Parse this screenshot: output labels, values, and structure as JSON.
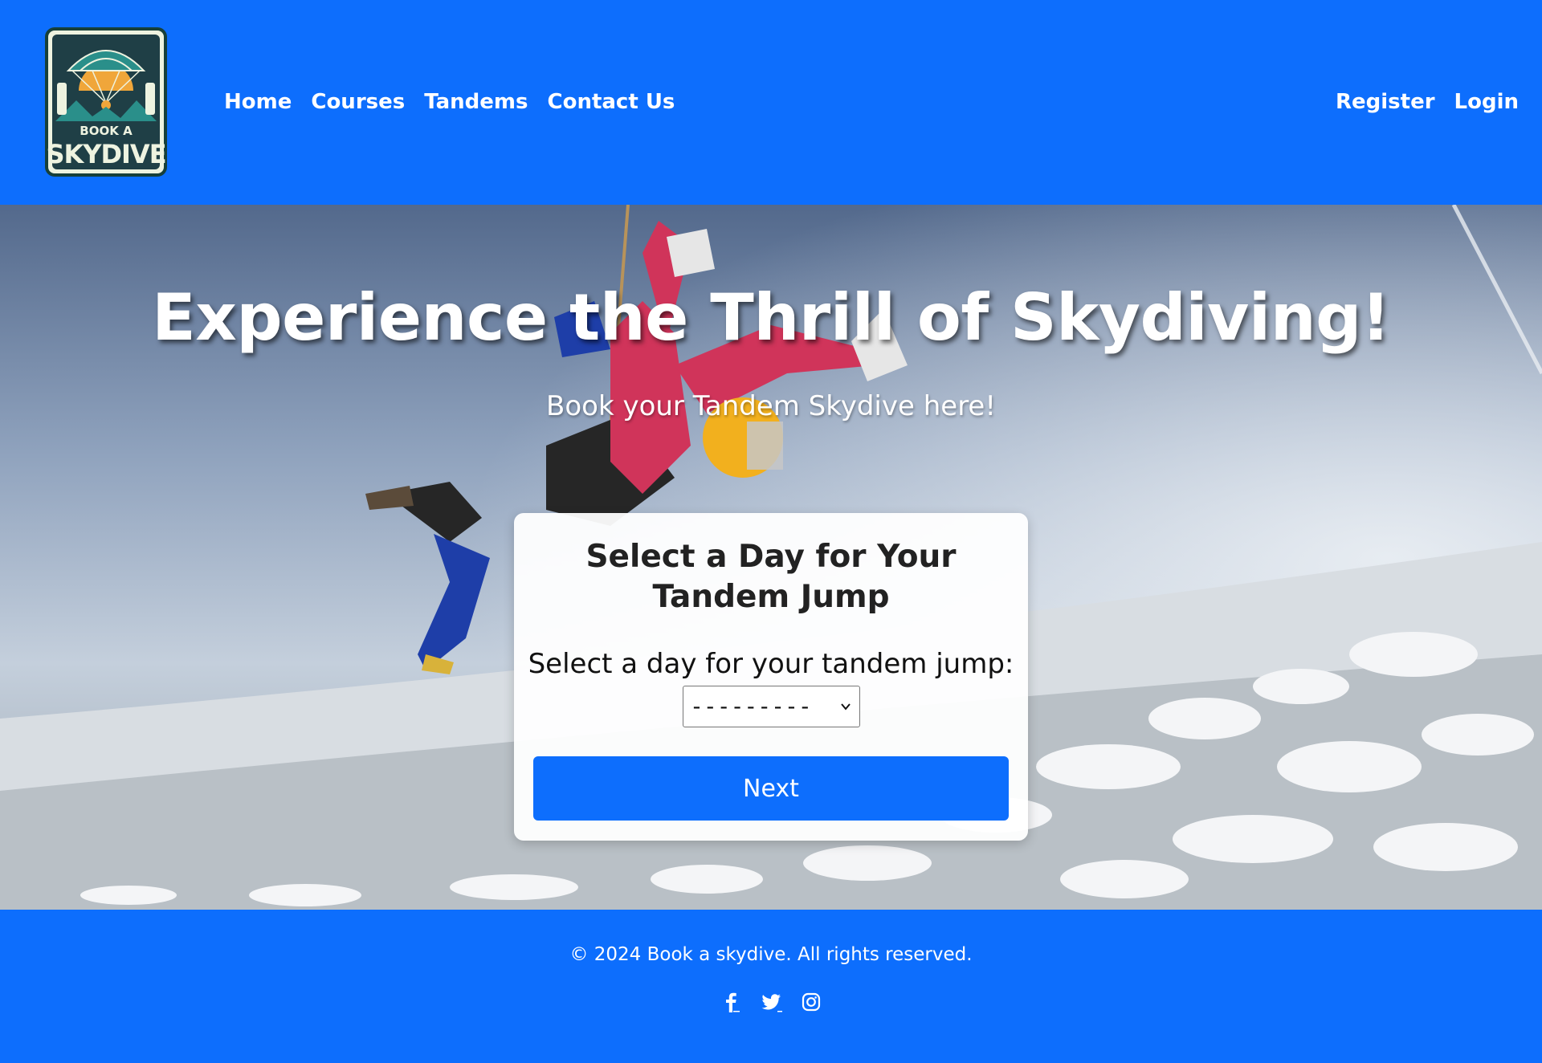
{
  "header": {
    "logo_text_top": "BOOK A",
    "logo_text_bottom": "SKYDIVE",
    "nav": [
      {
        "label": "Home"
      },
      {
        "label": "Courses"
      },
      {
        "label": "Tandems"
      },
      {
        "label": "Contact Us"
      }
    ],
    "auth": [
      {
        "label": "Register"
      },
      {
        "label": "Login"
      }
    ]
  },
  "hero": {
    "title": "Experience the Thrill of Skydiving!",
    "subtitle": "Book your Tandem Skydive here!"
  },
  "booking_card": {
    "title": "Select a Day for Your Tandem Jump",
    "field_label": "Select a day for your tandem jump:",
    "select_value": "---------",
    "next_label": "Next"
  },
  "footer": {
    "copyright": "© 2024 Book a skydive. All rights reserved.",
    "socials": [
      "facebook-icon",
      "twitter-icon",
      "instagram-icon"
    ]
  },
  "colors": {
    "primary": "#0d6efd",
    "white": "#ffffff",
    "card_text": "#222222"
  }
}
